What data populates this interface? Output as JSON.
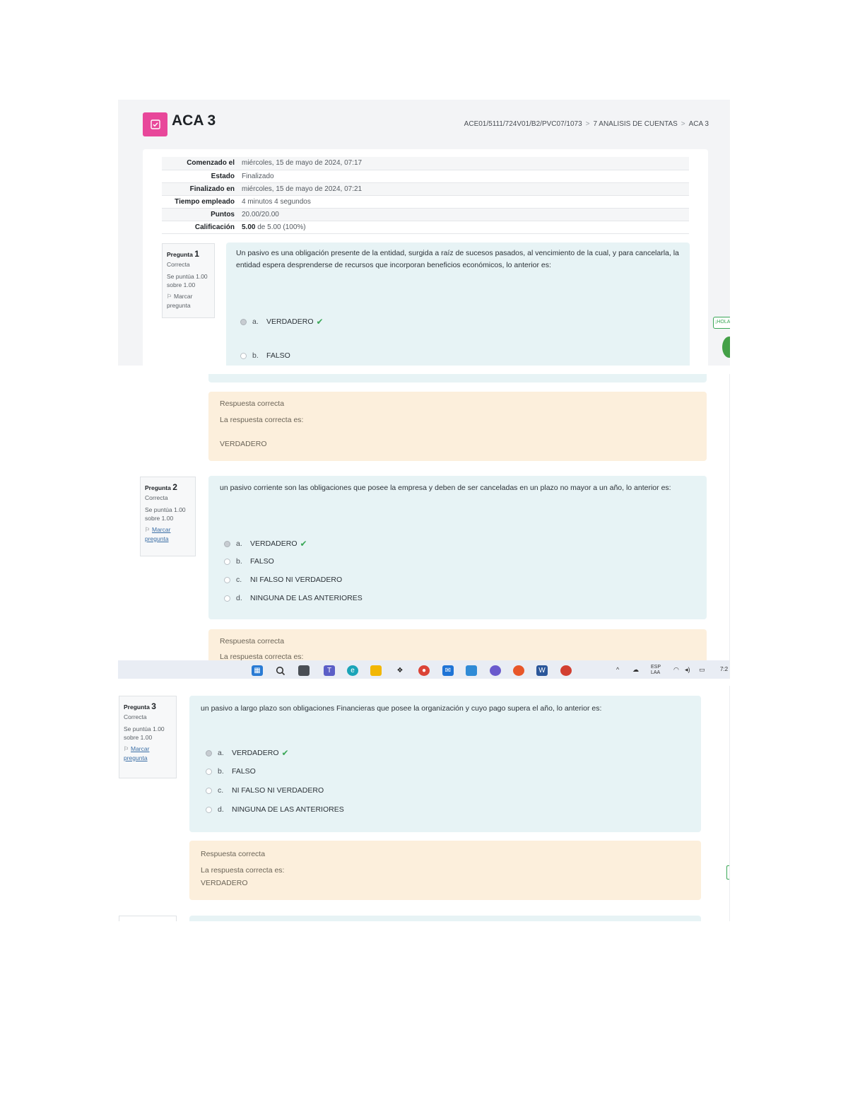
{
  "page": {
    "title": "ACA 3",
    "breadcrumb": [
      "ACE01/5111/724V01/B2/PVC07/1073",
      "7 ANALISIS DE CUENTAS",
      "ACA 3"
    ]
  },
  "summary": [
    {
      "label": "Comenzado el",
      "value": "miércoles, 15 de mayo de 2024, 07:17"
    },
    {
      "label": "Estado",
      "value": "Finalizado"
    },
    {
      "label": "Finalizado en",
      "value": "miércoles, 15 de mayo de 2024, 07:21"
    },
    {
      "label": "Tiempo empleado",
      "value": "4 minutos 4 segundos"
    },
    {
      "label": "Puntos",
      "value": "20.00/20.00"
    },
    {
      "label": "Calificación",
      "value_bold": "5.00",
      "value": "de 5.00 (100%)"
    }
  ],
  "questions": [
    {
      "label": "Pregunta",
      "number": "1",
      "status": "Correcta",
      "score": "Se puntúa 1.00 sobre 1.00",
      "flag": "Marcar pregunta",
      "text": "Un pasivo es una obligación presente de la entidad, surgida a raíz de sucesos pasados, al vencimiento de la cual, y para cancelarla, la entidad espera desprenderse de recursos que incorporan beneficios económicos, lo anterior es:",
      "options": [
        {
          "letter": "a.",
          "text": "VERDADERO",
          "selected": true
        },
        {
          "letter": "b.",
          "text": "FALSO",
          "selected": false
        }
      ],
      "feedback": {
        "title": "Respuesta correcta",
        "intro": "La respuesta correcta es:",
        "answer": "VERDADERO"
      }
    },
    {
      "label": "Pregunta",
      "number": "2",
      "status": "Correcta",
      "score": "Se puntúa 1.00 sobre 1.00",
      "flag": "Marcar pregunta",
      "text": "un pasivo corriente son las obligaciones que posee la empresa y deben de ser canceladas en un plazo no mayor a un año, lo anterior es:",
      "options": [
        {
          "letter": "a.",
          "text": "VERDADERO",
          "selected": true
        },
        {
          "letter": "b.",
          "text": "FALSO",
          "selected": false
        },
        {
          "letter": "c.",
          "text": "NI FALSO NI VERDADERO",
          "selected": false
        },
        {
          "letter": "d.",
          "text": "NINGUNA DE LAS ANTERIORES",
          "selected": false
        }
      ],
      "feedback": {
        "title": "Respuesta correcta",
        "intro": "La respuesta correcta es:"
      }
    },
    {
      "label": "Pregunta",
      "number": "3",
      "status": "Correcta",
      "score": "Se puntúa 1.00 sobre 1.00",
      "flag": "Marcar pregunta",
      "text": "un pasivo a largo plazo son obligaciones Financieras que posee la organización y cuyo pago supera el año, lo anterior es:",
      "options": [
        {
          "letter": "a.",
          "text": "VERDADERO",
          "selected": true
        },
        {
          "letter": "b.",
          "text": "FALSO",
          "selected": false
        },
        {
          "letter": "c.",
          "text": "NI FALSO NI VERDADERO",
          "selected": false
        },
        {
          "letter": "d.",
          "text": "NINGUNA DE LAS ANTERIORES",
          "selected": false
        }
      ],
      "feedback": {
        "title": "Respuesta correcta",
        "intro": "La respuesta correcta es:",
        "answer": "VERDADERO"
      }
    }
  ],
  "side_widget": {
    "label": "¡HOLA"
  },
  "taskbar": {
    "icons": [
      "windows-start-icon",
      "search-icon",
      "task-view-icon",
      "teams-icon",
      "edge-icon",
      "file-explorer-icon",
      "dropbox-icon",
      "chrome-icon",
      "mail-icon",
      "store-icon",
      "photos-icon",
      "firefox-icon",
      "word-icon",
      "chrome-dev-icon"
    ],
    "tray": {
      "language": "ESP",
      "region": "LAA",
      "time": "7:2"
    }
  },
  "colors": {
    "accent_pink": "#e8479a",
    "question_bg": "#e7f3f5",
    "feedback_bg": "#fcefdc",
    "check_green": "#3aa757"
  }
}
